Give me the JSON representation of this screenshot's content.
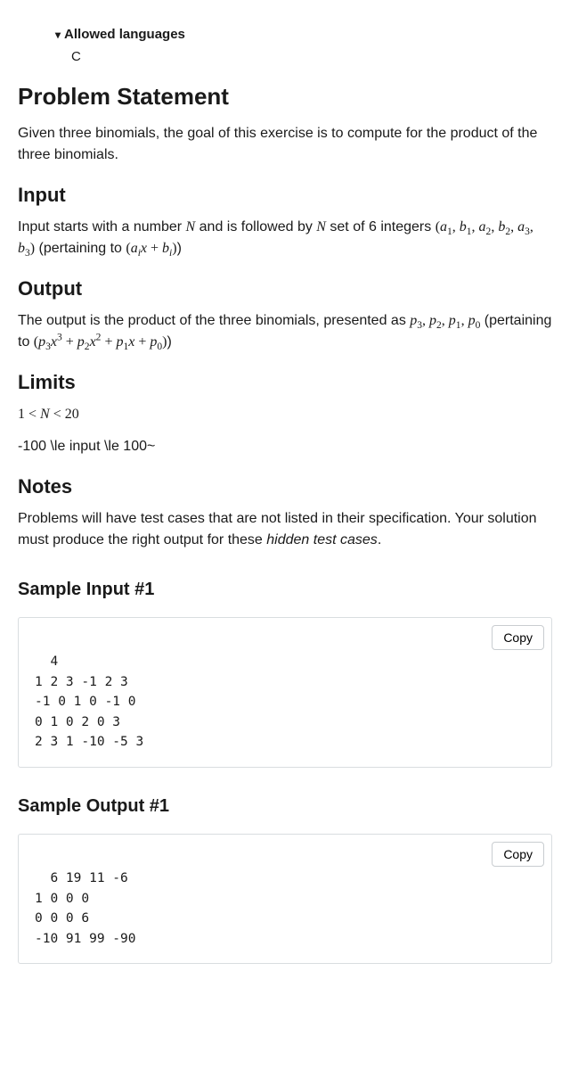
{
  "allowed_languages_label": "Allowed languages",
  "languages": "C",
  "headings": {
    "problem_statement": "Problem Statement",
    "input": "Input",
    "output": "Output",
    "limits": "Limits",
    "notes": "Notes",
    "sample_input_1": "Sample Input #1",
    "sample_output_1": "Sample Output #1"
  },
  "text": {
    "problem_statement": "Given three binomials, the goal of this exercise is to compute for the product of the three binomials.",
    "input_pre": "Input starts with a number ",
    "input_mid1": " and is followed by ",
    "input_mid2": " set of 6 integers ",
    "input_tuple": "(a₁, b₁, a₂, b₂, a₃, b₃)",
    "input_pertaining": " (pertaining to ",
    "input_binom": "(aᵢx + bᵢ)",
    "input_close": ")",
    "output_pre": "The output is the product of the three binomials, presented as ",
    "output_coeffs": "p₃, p₂, p₁, p₀",
    "output_pertaining": " (pertaining to ",
    "output_poly": "(p₃x³ + p₂x² + p₁x + p₀)",
    "output_close": ")",
    "limits_line1": "1 < N < 20",
    "limits_line2": "-100 \\le input \\le 100~",
    "notes_pre": "Problems will have test cases that are not listed in their specification. Your solution must produce the right output for these ",
    "notes_em": "hidden test cases",
    "notes_post": "."
  },
  "copy_label": "Copy",
  "sample_input_1": "4\n1 2 3 -1 2 3\n-1 0 1 0 -1 0\n0 1 0 2 0 3\n2 3 1 -10 -5 3",
  "sample_output_1": "6 19 11 -6\n1 0 0 0\n0 0 0 6\n-10 91 99 -90",
  "chart_data": null
}
